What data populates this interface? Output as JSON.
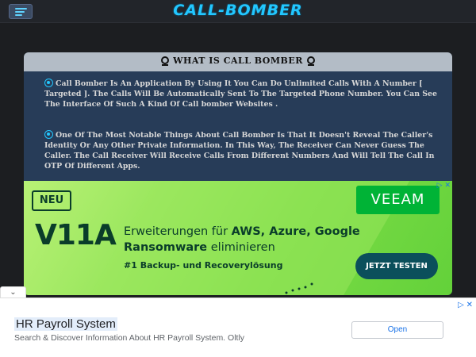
{
  "header": {
    "site_title": "CALL-BOMBER"
  },
  "card": {
    "title": "WHAT IS CALL BOMBER",
    "para1": "Call Bomber Is An Application By Using It You Can Do Unlimited Calls With A Number [ Targeted ]. The Calls Will Be Automatically Sent To The Targeted Phone Number. You Can See The Interface Of Such A Kind Of Call bomber Websites .",
    "para2": "One Of The Most Notable Things About Call Bomber Is That It Doesn't Reveal The Caller's Identity Or Any Other Private Information. In This Way, The Receiver Can Never Guess The Caller. The Call Receiver Will Receive Calls From Different Numbers And Will Tell The Call In OTP Of Different Apps."
  },
  "banner_ad": {
    "badge": "NEU",
    "product": "V11A",
    "line1_pre": "Erweiterungen für ",
    "line1_bold": "AWS, Azure, Google",
    "line2_bold": "Ransomware",
    "line2_post": " eliminieren",
    "line3": "#1 Backup- und Recoverylösung",
    "brand": "VEEAM",
    "cta": "JETZT TESTEN",
    "corner": "▷ ✕"
  },
  "bottom_ad": {
    "collapse": "⌄",
    "badge": "▷ ✕",
    "title": "HR Payroll System",
    "description": "Search & Discover Information About HR Payroll System. Oltly",
    "open_label": "Open"
  }
}
